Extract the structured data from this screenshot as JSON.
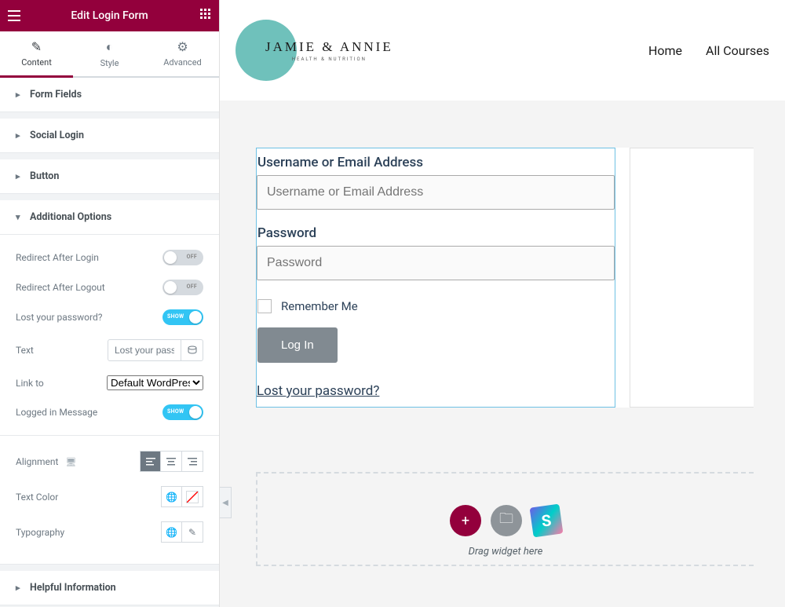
{
  "header": {
    "title": "Edit Login Form"
  },
  "tabs": [
    {
      "label": "Content"
    },
    {
      "label": "Style"
    },
    {
      "label": "Advanced"
    }
  ],
  "sections": {
    "form_fields": "Form Fields",
    "social_login": "Social Login",
    "button": "Button",
    "additional_options": "Additional Options",
    "helpful_information": "Helpful Information"
  },
  "controls": {
    "redirect_after_login": {
      "label": "Redirect After Login",
      "state": "OFF"
    },
    "redirect_after_logout": {
      "label": "Redirect After Logout",
      "state": "OFF"
    },
    "lost_password": {
      "label": "Lost your password?",
      "state": "SHOW"
    },
    "text": {
      "label": "Text",
      "value": "Lost your passw"
    },
    "link_to": {
      "label": "Link to",
      "value": "Default WordPress"
    },
    "logged_in_message": {
      "label": "Logged in Message",
      "state": "SHOW"
    },
    "alignment": {
      "label": "Alignment"
    },
    "text_color": {
      "label": "Text Color"
    },
    "typography": {
      "label": "Typography"
    }
  },
  "site": {
    "logo_line1": "JAMIE & ANNIE",
    "logo_line2": "HEALTH & NUTRITION",
    "nav": {
      "home": "Home",
      "courses": "All Courses"
    }
  },
  "form": {
    "username_label": "Username or Email Address",
    "username_placeholder": "Username or Email Address",
    "password_label": "Password",
    "password_placeholder": "Password",
    "remember": "Remember Me",
    "login_button": "Log In",
    "lost_link": "Lost your password?"
  },
  "dropzone": {
    "hint": "Drag widget here"
  }
}
